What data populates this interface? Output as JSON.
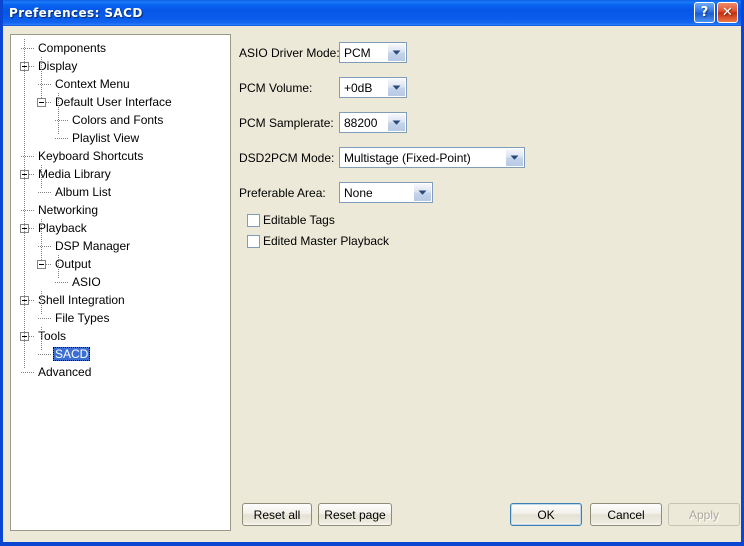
{
  "window": {
    "title": "Preferences: SACD",
    "help_button": "?",
    "close_button": "✕"
  },
  "sidebar": {
    "items": [
      {
        "label": "Components",
        "level": 1,
        "expandable": false,
        "selected": false
      },
      {
        "label": "Display",
        "level": 1,
        "expandable": true,
        "selected": false
      },
      {
        "label": "Context Menu",
        "level": 2,
        "expandable": false,
        "selected": false
      },
      {
        "label": "Default User Interface",
        "level": 2,
        "expandable": true,
        "selected": false
      },
      {
        "label": "Colors and Fonts",
        "level": 3,
        "expandable": false,
        "selected": false
      },
      {
        "label": "Playlist View",
        "level": 3,
        "expandable": false,
        "selected": false
      },
      {
        "label": "Keyboard Shortcuts",
        "level": 1,
        "expandable": false,
        "selected": false
      },
      {
        "label": "Media Library",
        "level": 1,
        "expandable": true,
        "selected": false
      },
      {
        "label": "Album List",
        "level": 2,
        "expandable": false,
        "selected": false
      },
      {
        "label": "Networking",
        "level": 1,
        "expandable": false,
        "selected": false
      },
      {
        "label": "Playback",
        "level": 1,
        "expandable": true,
        "selected": false
      },
      {
        "label": "DSP Manager",
        "level": 2,
        "expandable": false,
        "selected": false
      },
      {
        "label": "Output",
        "level": 2,
        "expandable": true,
        "selected": false
      },
      {
        "label": "ASIO",
        "level": 3,
        "expandable": false,
        "selected": false
      },
      {
        "label": "Shell Integration",
        "level": 1,
        "expandable": true,
        "selected": false
      },
      {
        "label": "File Types",
        "level": 2,
        "expandable": false,
        "selected": false
      },
      {
        "label": "Tools",
        "level": 1,
        "expandable": true,
        "selected": false
      },
      {
        "label": "SACD",
        "level": 2,
        "expandable": false,
        "selected": true
      },
      {
        "label": "Advanced",
        "level": 1,
        "expandable": false,
        "selected": false
      }
    ]
  },
  "main": {
    "fields": [
      {
        "label": "ASIO Driver Mode:",
        "value": "PCM",
        "width": 68
      },
      {
        "label": "PCM Volume:",
        "value": "+0dB",
        "width": 68
      },
      {
        "label": "PCM Samplerate:",
        "value": "88200",
        "width": 68
      },
      {
        "label": "DSD2PCM Mode:",
        "value": "Multistage (Fixed-Point)",
        "width": 186
      },
      {
        "label": "Preferable Area:",
        "value": "None",
        "width": 94
      }
    ],
    "checkboxes": [
      {
        "label": "Editable Tags",
        "checked": false
      },
      {
        "label": "Edited Master Playback",
        "checked": false
      }
    ]
  },
  "footer": {
    "reset_all": "Reset all",
    "reset_page": "Reset page",
    "ok": "OK",
    "cancel": "Cancel",
    "apply": "Apply",
    "apply_disabled": true
  },
  "colors": {
    "titlebar_blue": "#0A5CEC",
    "dialog_background": "#ECE9D8",
    "selection_blue": "#3B6FD4",
    "combo_border": "#7F9DB9",
    "close_red": "#C32E0D"
  }
}
